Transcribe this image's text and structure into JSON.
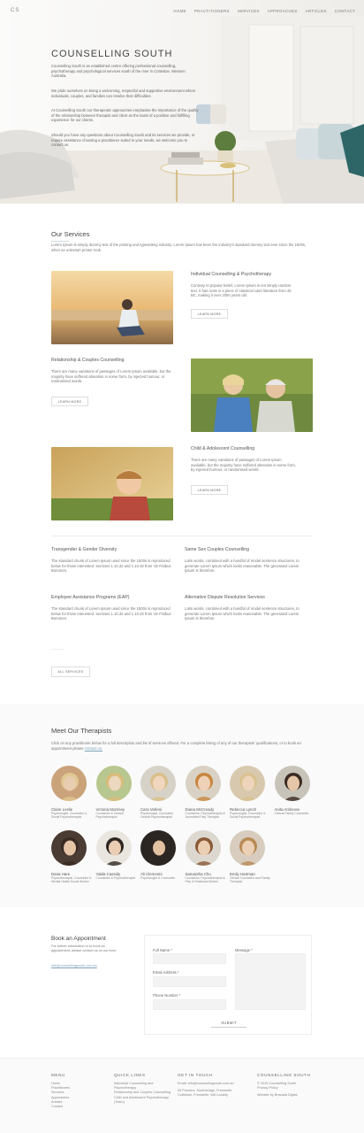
{
  "brand": {
    "logo": "CS"
  },
  "nav": {
    "items": [
      "HOME",
      "PRACTITIONERS",
      "SERVICES",
      "APPROACHES",
      "ARTICLES",
      "CONTACT"
    ]
  },
  "hero": {
    "title": "COUNSELLING SOUTH",
    "paragraphs": [
      "Counselling South is an established centre offering professional counselling, psychotherapy and psychological services south of the river in Cottesloe, Western Australia.",
      "We pride ourselves on being a welcoming, respectful and supportive environment where individuals, couples, and families can resolve their difficulties.",
      "At Counselling South our therapeutic approaches emphasise the importance of the quality of the relationship between therapist and client as the basis of a positive and fulfilling experience for our clients.",
      "Should you have any questions about Counselling South and its services we provide, or require assistance choosing a practitioner suited to your needs, we welcome you to contact us."
    ]
  },
  "services": {
    "title": "Our Services",
    "intro": "Lorem Ipsum is simply dummy text of the printing and typesetting industry. Lorem Ipsum has been the industry's standard dummy text ever since the 1500s, when an unknown printer took.",
    "featured": [
      {
        "title": "Individual Counselling & Psychotherapy",
        "text": "Contrary to popular belief, Lorem Ipsum is not simply random text. It has roots in a piece of classical Latin literature from 45 BC, making it over 2000 years old.",
        "button": "LEARN MORE"
      },
      {
        "title": "Relationship & Couples Counselling",
        "text": "There are many variations of passages of Lorem Ipsum available, but the majority have suffered alteration in some form, by injected humour, or randomised words.",
        "button": "LEARN MORE"
      },
      {
        "title": "Child & Adolescent Counselling",
        "text": "There are many variations of passages of Lorem Ipsum available, but the majority have suffered alteration in some form, by injected humour, or randomised words.",
        "button": "LEARN MORE"
      }
    ],
    "others": [
      {
        "title": "Transgender & Gender Diversity",
        "text": "The standard chunk of Lorem Ipsum used since the 1500s is reproduced below for those interested. Sections 1.10.32 and 1.10.33 from 'de Finibus Bonorum."
      },
      {
        "title": "Same Sex Couples Counselling",
        "text": "Latin words, combined with a handful of model sentence structures, to generate Lorem Ipsum which looks reasonable. The generated Lorem Ipsum is therefore."
      },
      {
        "title": "Employee Assistance Programs (EAP)",
        "text": "The standard chunk of Lorem Ipsum used since the 1500s is reproduced below for those interested. Sections 1.10.32 and 1.10.33 from 'de Finibus Bonorum."
      },
      {
        "title": "Alternative Dispute Resolution Services",
        "text": "Latin words, combined with a handful of model sentence structures, to generate Lorem Ipsum which looks reasonable. The generated Lorem Ipsum is therefore."
      }
    ],
    "all_button": "ALL SERVICES"
  },
  "therapists": {
    "title": "Meet Our Therapists",
    "intro": "Click on any practitioner below for a full description and list of services offered. For a complete listing of any of our therapists' qualifications, or to book an appointment please",
    "intro_link": "contact us.",
    "people": [
      {
        "name": "Claire Leslie",
        "role": "Psychologist, Counsellor & Social Psychotherapist"
      },
      {
        "name": "Victoria Morrisey",
        "role": "Counsellor & Gestalt Psychotherapist"
      },
      {
        "name": "Cara Varleni",
        "role": "Psychologist, Counsellor Gestalt Psychotherapist"
      },
      {
        "name": "Diana McCready",
        "role": "Counsellor, Psychotherapist & Accredited Play Therapist"
      },
      {
        "name": "Rebecca Lynch",
        "role": "Psychologist, Counsellor & Social Psychotherapist"
      },
      {
        "name": "Anita Ambrose",
        "role": "Clinical Family Counsellor"
      },
      {
        "name": "Dana Hare",
        "role": "Psychotherapist, Counsellor & Mental Health Social Worker"
      },
      {
        "name": "Yalda Cassidy",
        "role": "Counsellor & Psychotherapist"
      },
      {
        "name": "Ali Clements",
        "role": "Psychologist & Counsellor"
      },
      {
        "name": "Samantha Chu",
        "role": "Counsellor, Psychotherapist & Play & Relational Worker"
      },
      {
        "name": "Emily Hartman",
        "role": "Clinical Counsellor and Family Therapist"
      }
    ]
  },
  "booking": {
    "title": "Book an Appointment",
    "text": "For further information or to book an appointment, please contact us on our form.",
    "email": "info@counsellingsouth.com.au",
    "fields": {
      "full_name": "Full Name *",
      "email": "Email Address *",
      "phone": "Phone Number *",
      "message": "Message *"
    },
    "submit": "SUBMIT"
  },
  "footer": {
    "menu": {
      "title": "MENU",
      "items": [
        "Home",
        "Practitioners",
        "Services",
        "Approaches",
        "Articles",
        "Contact"
      ]
    },
    "quick": {
      "title": "QUICK LINKS",
      "items": [
        "Individual Counselling and Psychotherapy",
        "Relationship and Couples Counselling",
        "Child and Adolescent Psychotherapy (Team)"
      ]
    },
    "contact": {
      "title": "GET IN TOUCH",
      "items": [
        "Email: Info@counsellingsouth.com.au",
        "26 Pruniers, Southbridge, Fremantle Cottesloe, Fremantle, WA Locality"
      ]
    },
    "about": {
      "title": "COUNSELLING SOUTH",
      "items": [
        "© 2019 Counselling South",
        "Privacy Policy",
        "Website by Bravada Digital"
      ]
    }
  },
  "colors": {
    "accent": "#7ea1b8",
    "text": "#555555"
  }
}
